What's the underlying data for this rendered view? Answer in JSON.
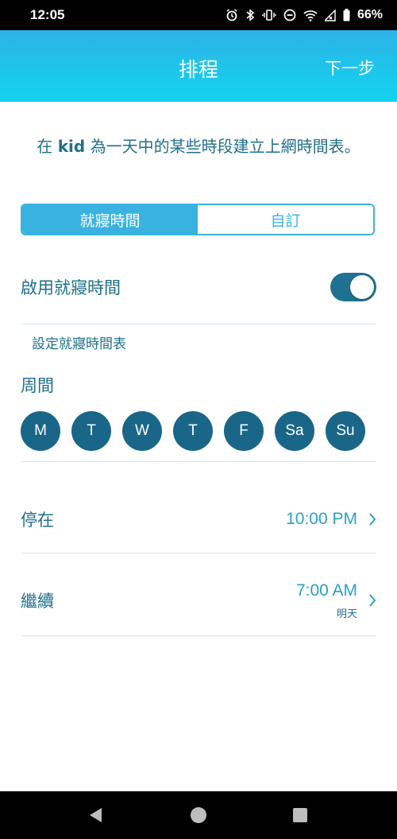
{
  "status_bar": {
    "time": "12:05",
    "battery": "66%",
    "icons": [
      "alarm-icon",
      "bluetooth-icon",
      "vibrate-icon",
      "dnd-icon",
      "wifi-icon",
      "signal-icon",
      "battery-icon"
    ]
  },
  "app_bar": {
    "title": "排程",
    "next_label": "下一步"
  },
  "intro": {
    "prefix": "在 ",
    "name": "kid",
    "suffix": " 為一天中的某些時段建立上網時間表。"
  },
  "tabs": {
    "bedtime": "就寢時間",
    "custom": "自訂",
    "active": "bedtime"
  },
  "enable_bedtime": {
    "label": "啟用就寢時間",
    "enabled": true
  },
  "set_schedule_label": "設定就寢時間表",
  "weekdays": {
    "label": "周間",
    "days": [
      "M",
      "T",
      "W",
      "T",
      "F",
      "Sa",
      "Su"
    ]
  },
  "pause": {
    "label": "停在",
    "time": "10:00 PM"
  },
  "resume": {
    "label": "繼續",
    "time": "7:00 AM",
    "note": "明天"
  },
  "colors": {
    "header_start": "#2fb2e6",
    "header_end": "#14d2ef",
    "accent": "#3ab2e0",
    "dark_teal": "#1a6688",
    "text": "#1f6f8a"
  }
}
